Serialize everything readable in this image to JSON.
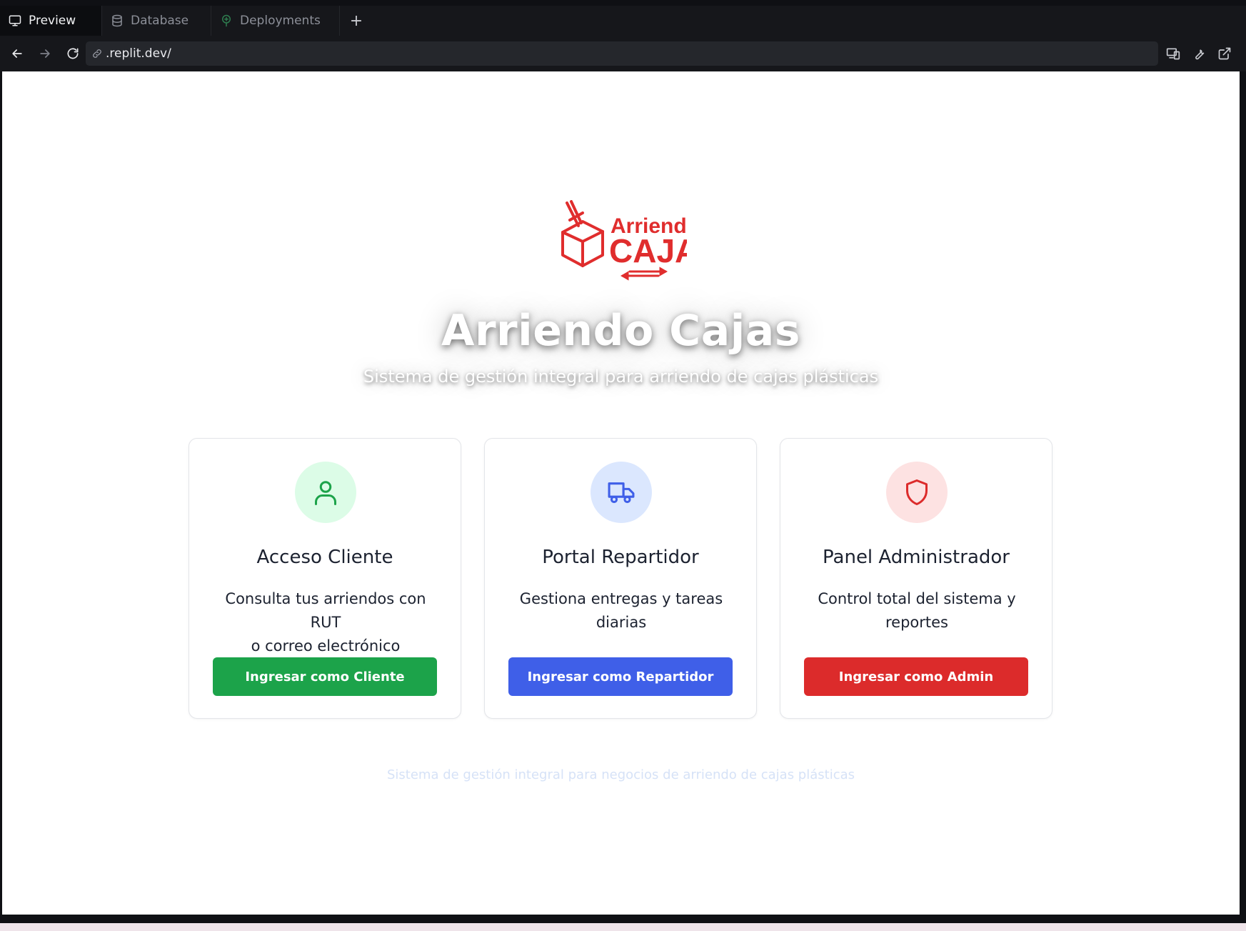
{
  "tabs": [
    {
      "label": "Preview",
      "icon": "monitor-icon"
    },
    {
      "label": "Database",
      "icon": "database-icon"
    },
    {
      "label": "Deployments",
      "icon": "deployments-icon"
    }
  ],
  "add_tab_label": "+",
  "address_bar": {
    "url": ".replit.dev/"
  },
  "page": {
    "logo": {
      "line1": "Arriendo",
      "line2": "CAJAS",
      "color": "#e02d2d"
    },
    "title": "Arriendo Cajas",
    "subtitle": "Sistema de gestión integral para arriendo de cajas plásticas",
    "cards": [
      {
        "icon": "user-icon",
        "title": "Acceso Cliente",
        "desc_line1": "Consulta tus arriendos con RUT",
        "desc_line2": "o correo electrónico",
        "button": "Ingresar como Cliente",
        "accent": "#1ca34a",
        "icon_bg": "#dcfce7"
      },
      {
        "icon": "truck-icon",
        "title": "Portal Repartidor",
        "desc_line1": "Gestiona entregas y tareas",
        "desc_line2": "diarias",
        "button": "Ingresar como Repartidor",
        "accent": "#3f5fe8",
        "icon_bg": "#dbe7fe"
      },
      {
        "icon": "shield-icon",
        "title": "Panel Administrador",
        "desc_line1": "Control total del sistema y",
        "desc_line2": "reportes",
        "button": "Ingresar como Admin",
        "accent": "#dc2b2b",
        "icon_bg": "#fde2e2"
      }
    ],
    "footer": "Sistema de gestión integral para negocios de arriendo de cajas plásticas"
  }
}
